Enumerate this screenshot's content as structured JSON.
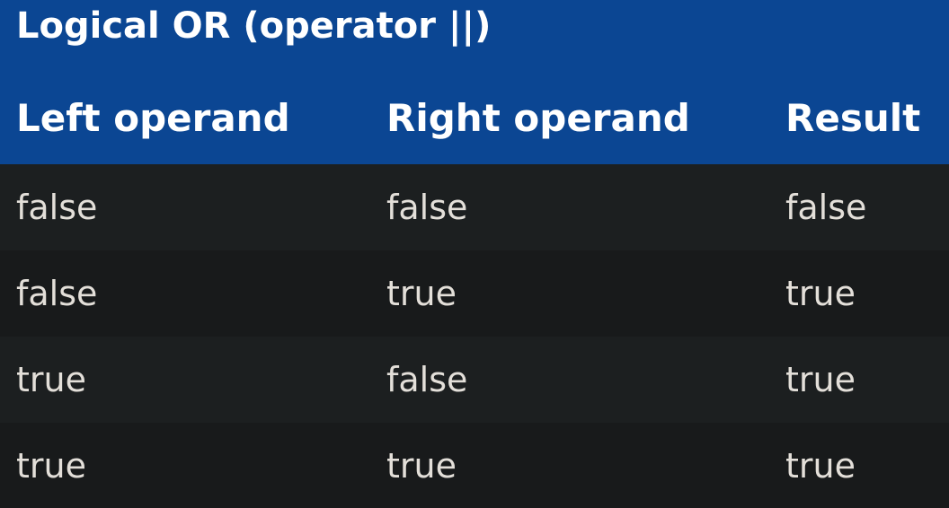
{
  "table": {
    "caption": "Logical OR (operator ||)",
    "headers": [
      "Left operand",
      "Right operand",
      "Result"
    ],
    "rows": [
      [
        "false",
        "false",
        "false"
      ],
      [
        "false",
        "true",
        "true"
      ],
      [
        "true",
        "false",
        "true"
      ],
      [
        "true",
        "true",
        "true"
      ]
    ]
  },
  "colors": {
    "header_background": "#0b4693",
    "header_text": "#ffffff",
    "row_background": "#1c1f20",
    "row_alt_background": "#181a1b",
    "cell_text": "#e3dfd9"
  }
}
